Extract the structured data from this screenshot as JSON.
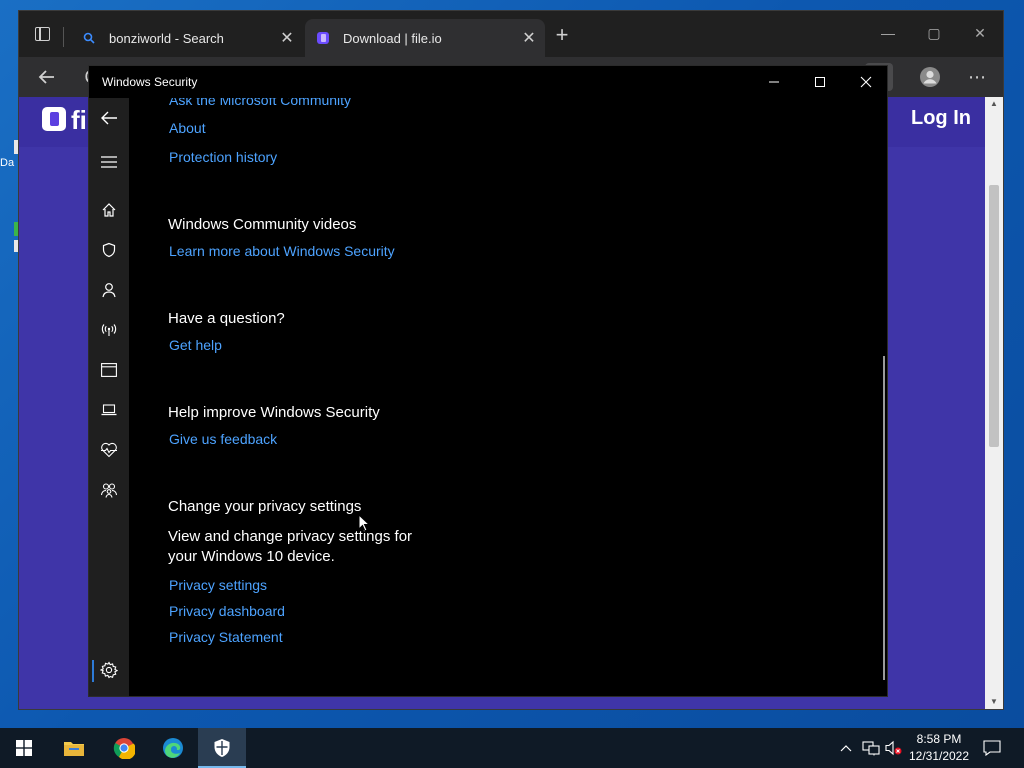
{
  "desktop": {
    "fragment_label": "Da"
  },
  "browser": {
    "tabs": [
      {
        "title": "bonziworld - Search",
        "close": "✕"
      },
      {
        "title": "Download | file.io",
        "close": "✕"
      }
    ],
    "new_tab": "+",
    "address_fragment": "C",
    "more": "⋯"
  },
  "site": {
    "name_fragment": "fi",
    "login_label": "Log In",
    "background_color": "#3f35a8"
  },
  "security": {
    "window_title": "Windows Security",
    "links_top": [
      "Ask the Microsoft Community",
      "About",
      "Protection history"
    ],
    "community": {
      "heading": "Windows Community videos",
      "link": "Learn more about Windows Security"
    },
    "question": {
      "heading": "Have a question?",
      "link": "Get help"
    },
    "improve": {
      "heading": "Help improve Windows Security",
      "link": "Give us feedback"
    },
    "privacy": {
      "heading": "Change your privacy settings",
      "description": "View and change privacy settings for your Windows 10 device.",
      "links": [
        "Privacy settings",
        "Privacy dashboard",
        "Privacy Statement"
      ]
    },
    "link_color": "#4da3ff",
    "accent_color": "#2d7ad6"
  },
  "taskbar": {
    "time": "8:58 PM",
    "date": "12/31/2022"
  }
}
